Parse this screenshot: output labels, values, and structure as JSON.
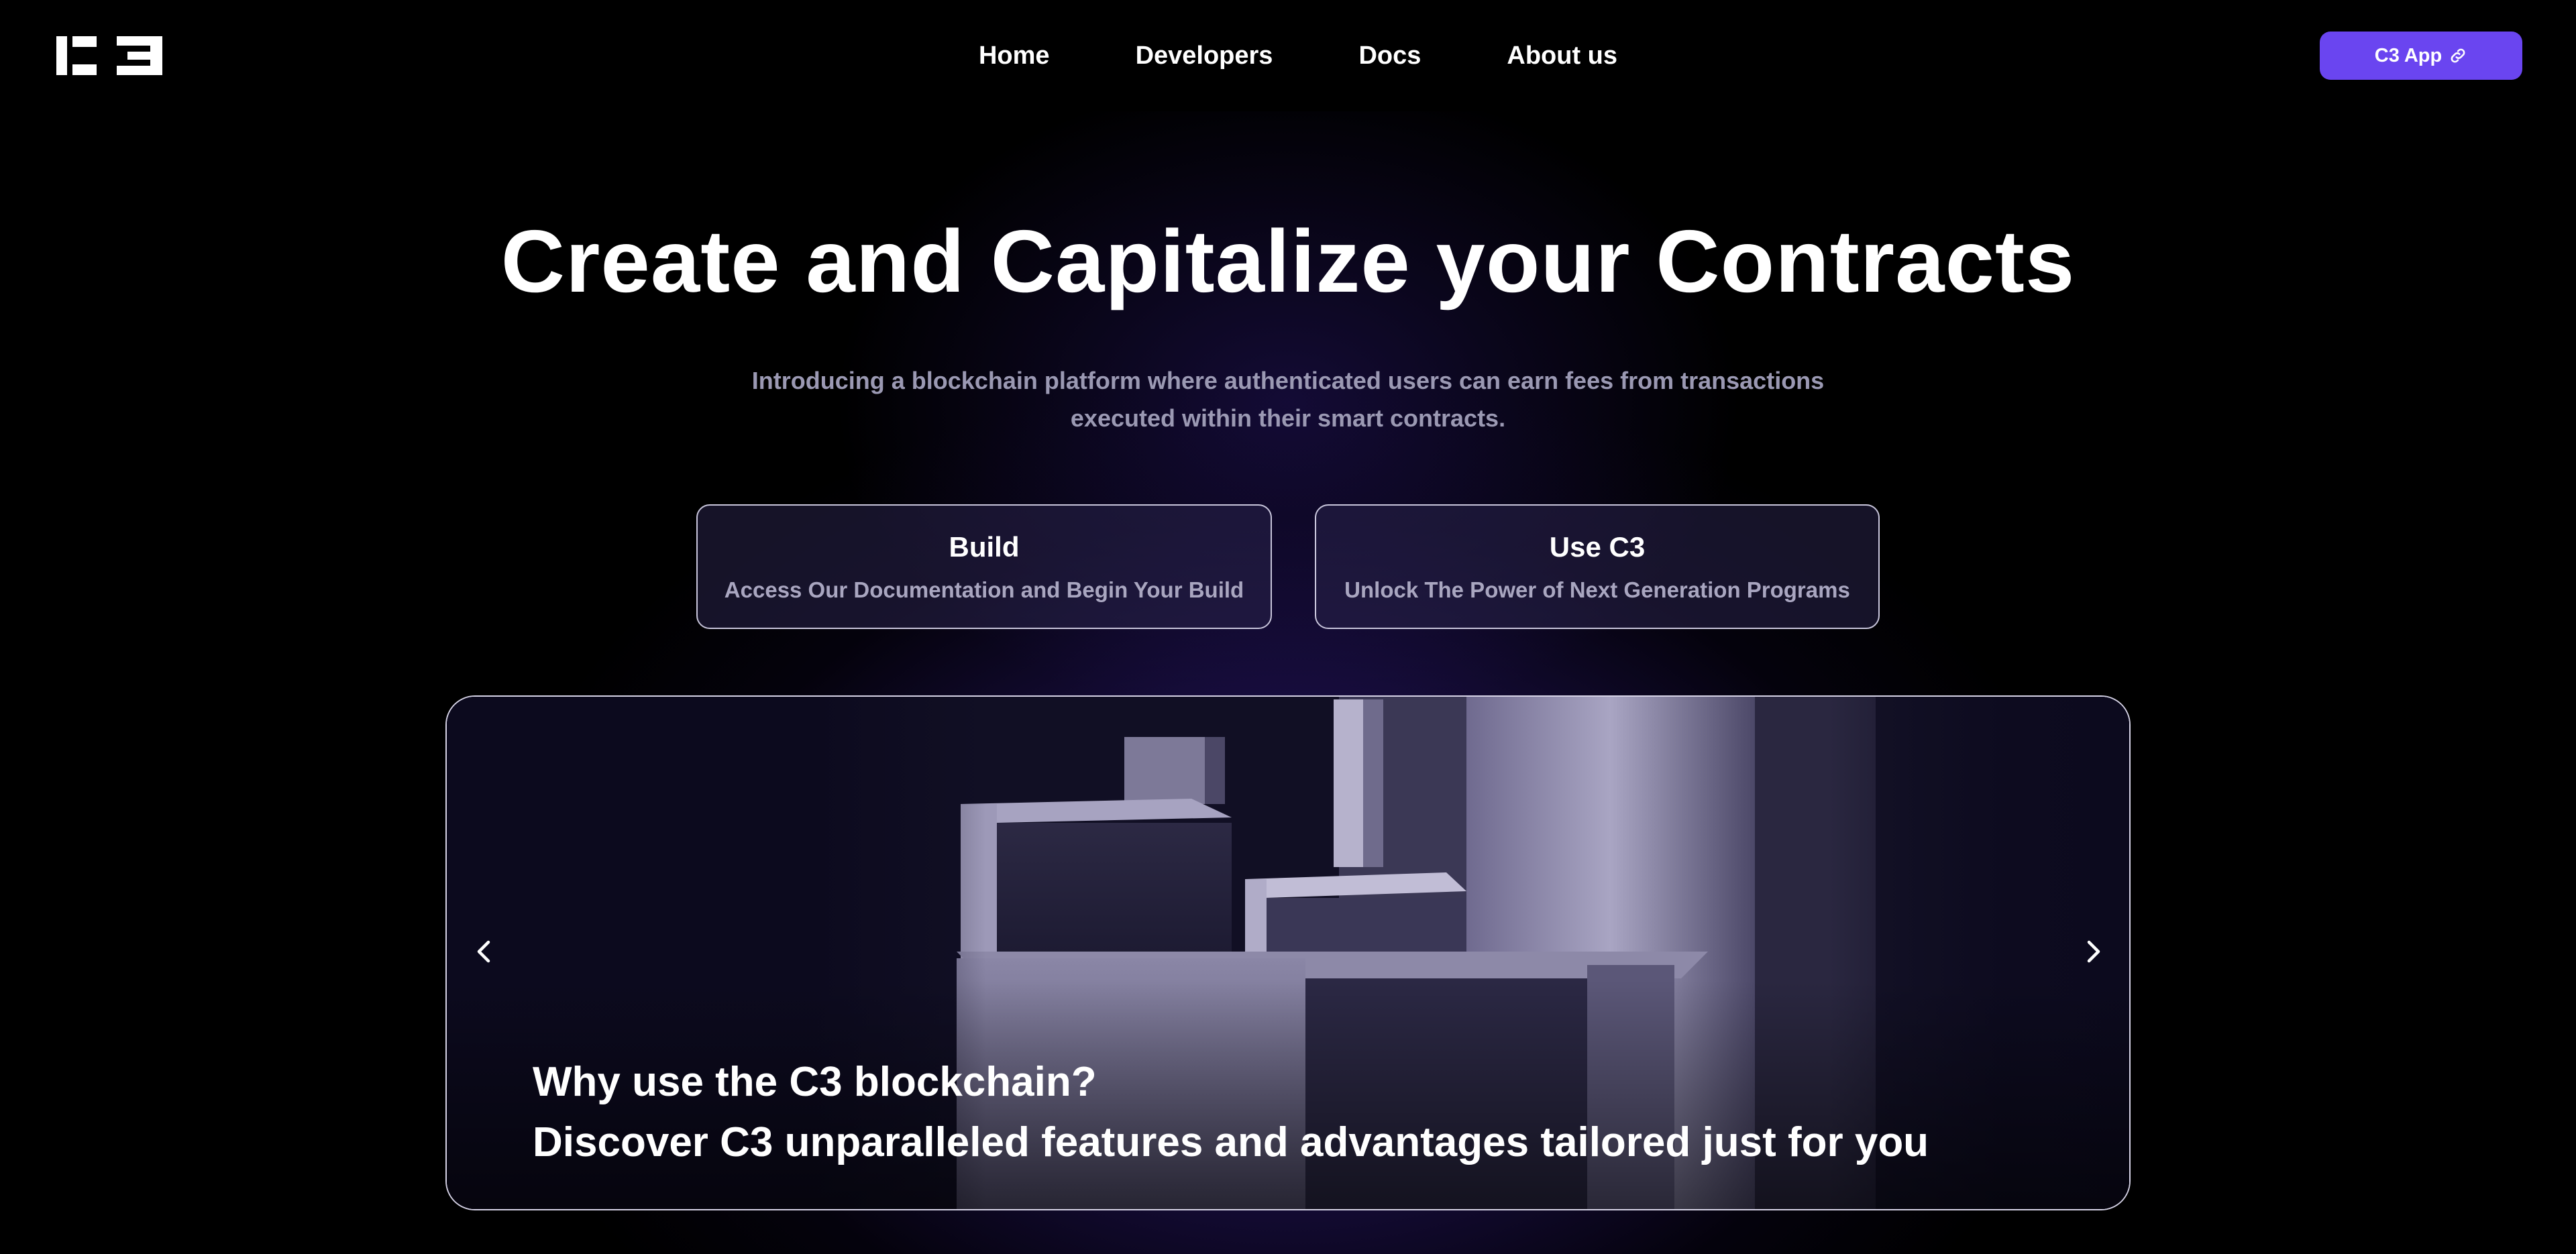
{
  "header": {
    "logo_text": "C3",
    "nav": [
      {
        "label": "Home"
      },
      {
        "label": "Developers"
      },
      {
        "label": "Docs"
      },
      {
        "label": "About us"
      }
    ],
    "app_button": {
      "label": "C3 App",
      "icon": "link-icon"
    }
  },
  "hero": {
    "title": "Create and Capitalize your Contracts",
    "subtitle": "Introducing a blockchain platform where authenticated users can earn fees from transactions executed within their smart contracts."
  },
  "cards": [
    {
      "title": "Build",
      "description": "Access Our Documentation and Begin Your Build"
    },
    {
      "title": "Use C3",
      "description": "Unlock The Power of Next Generation Programs"
    }
  ],
  "carousel": {
    "slide_heading": "Why use the C3 blockchain?",
    "slide_subheading": "Discover C3 unparalleled features and advantages tailored just for you",
    "prev_icon": "chevron-left-icon",
    "next_icon": "chevron-right-icon"
  },
  "colors": {
    "background": "#000000",
    "accent": "#6a45f0",
    "glow": "#5c3cdc",
    "muted_text": "#9b99b3"
  }
}
